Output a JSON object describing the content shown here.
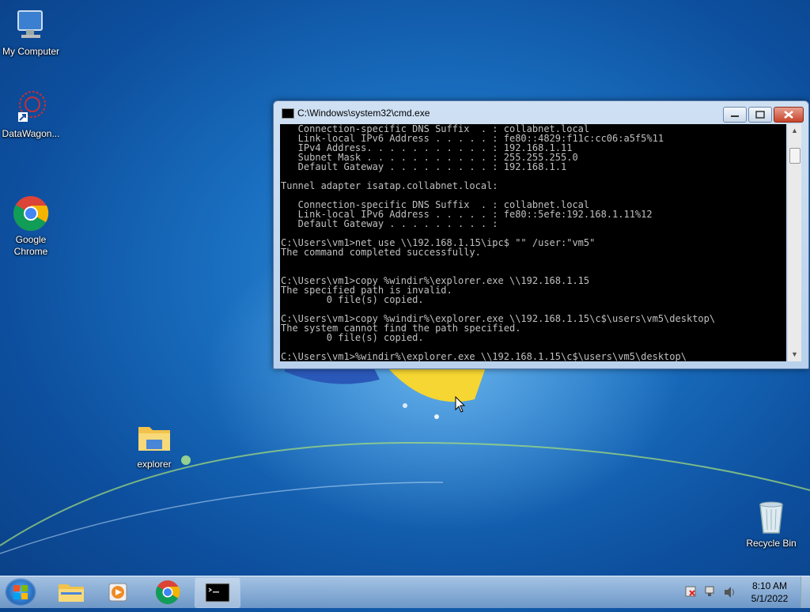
{
  "desktop": {
    "icons": [
      {
        "label": "My Computer"
      },
      {
        "label": "DataWagon..."
      },
      {
        "label": "Google\nChrome"
      },
      {
        "label": "explorer"
      },
      {
        "label": "Recycle Bin"
      }
    ]
  },
  "cmd_window": {
    "title": "C:\\Windows\\system32\\cmd.exe",
    "lines": [
      "   Connection-specific DNS Suffix  . : collabnet.local",
      "   Link-local IPv6 Address . . . . . : fe80::4829:f11c:cc06:a5f5%11",
      "   IPv4 Address. . . . . . . . . . . : 192.168.1.11",
      "   Subnet Mask . . . . . . . . . . . : 255.255.255.0",
      "   Default Gateway . . . . . . . . . : 192.168.1.1",
      "",
      "Tunnel adapter isatap.collabnet.local:",
      "",
      "   Connection-specific DNS Suffix  . : collabnet.local",
      "   Link-local IPv6 Address . . . . . : fe80::5efe:192.168.1.11%12",
      "   Default Gateway . . . . . . . . . :",
      "",
      "C:\\Users\\vm1>net use \\\\192.168.1.15\\ipc$ \"\" /user:\"vm5\"",
      "The command completed successfully.",
      "",
      "",
      "C:\\Users\\vm1>copy %windir%\\explorer.exe \\\\192.168.1.15",
      "The specified path is invalid.",
      "        0 file(s) copied.",
      "",
      "C:\\Users\\vm1>copy %windir%\\explorer.exe \\\\192.168.1.15\\c$\\users\\vm5\\desktop\\",
      "The system cannot find the path specified.",
      "        0 file(s) copied.",
      "",
      "C:\\Users\\vm1>%windir%\\explorer.exe \\\\192.168.1.15\\c$\\users\\vm5\\desktop\\"
    ]
  },
  "taskbar": {
    "clock_time": "8:10 AM",
    "clock_date": "5/1/2022",
    "pinned": [
      "file-explorer-icon",
      "media-player-icon",
      "chrome-icon",
      "cmd-icon"
    ]
  }
}
